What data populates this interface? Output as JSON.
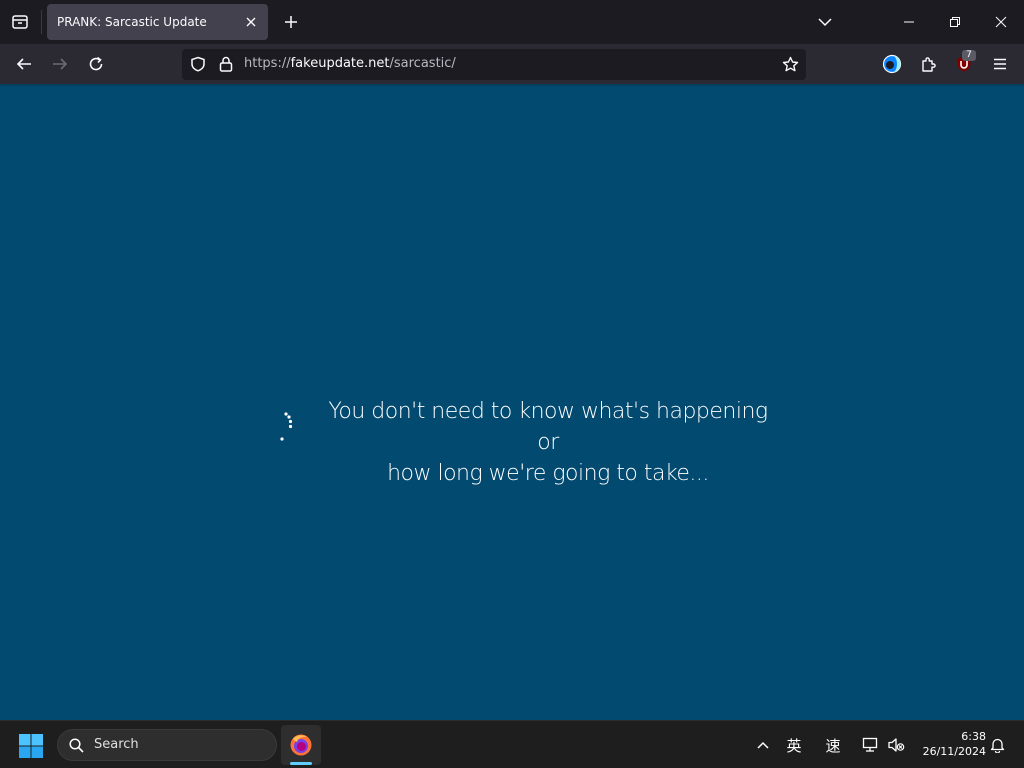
{
  "browser": {
    "tab": {
      "title": "PRANK: Sarcastic Update"
    },
    "url": {
      "scheme": "https://",
      "host": "fakeupdate.net",
      "path": "/sarcastic/"
    },
    "extension_badge": "7"
  },
  "page": {
    "message_line1": "You don't need to know what's happening or",
    "message_line2": "how long we're going to take...",
    "background_color": "#034a70"
  },
  "taskbar": {
    "search_label": "Search",
    "ime_lang": "英",
    "ime_mode": "速",
    "clock_time": "6:38",
    "clock_date": "26/11/2024"
  },
  "icons": {
    "tabstrip": [
      "tab-list-icon",
      "close-icon",
      "plus-icon",
      "chevron-down-icon",
      "minimize-icon",
      "restore-icon",
      "window-close-icon"
    ],
    "navbar": [
      "back-arrow-icon",
      "forward-arrow-icon",
      "reload-icon",
      "shield-icon",
      "lock-icon",
      "star-icon",
      "firefox-account-icon",
      "extensions-icon",
      "ublock-icon",
      "hamburger-menu-icon"
    ],
    "taskbar": [
      "windows-start-icon",
      "search-icon",
      "firefox-icon",
      "chevron-up-icon",
      "network-icon",
      "volume-muted-icon",
      "bell-icon"
    ]
  }
}
